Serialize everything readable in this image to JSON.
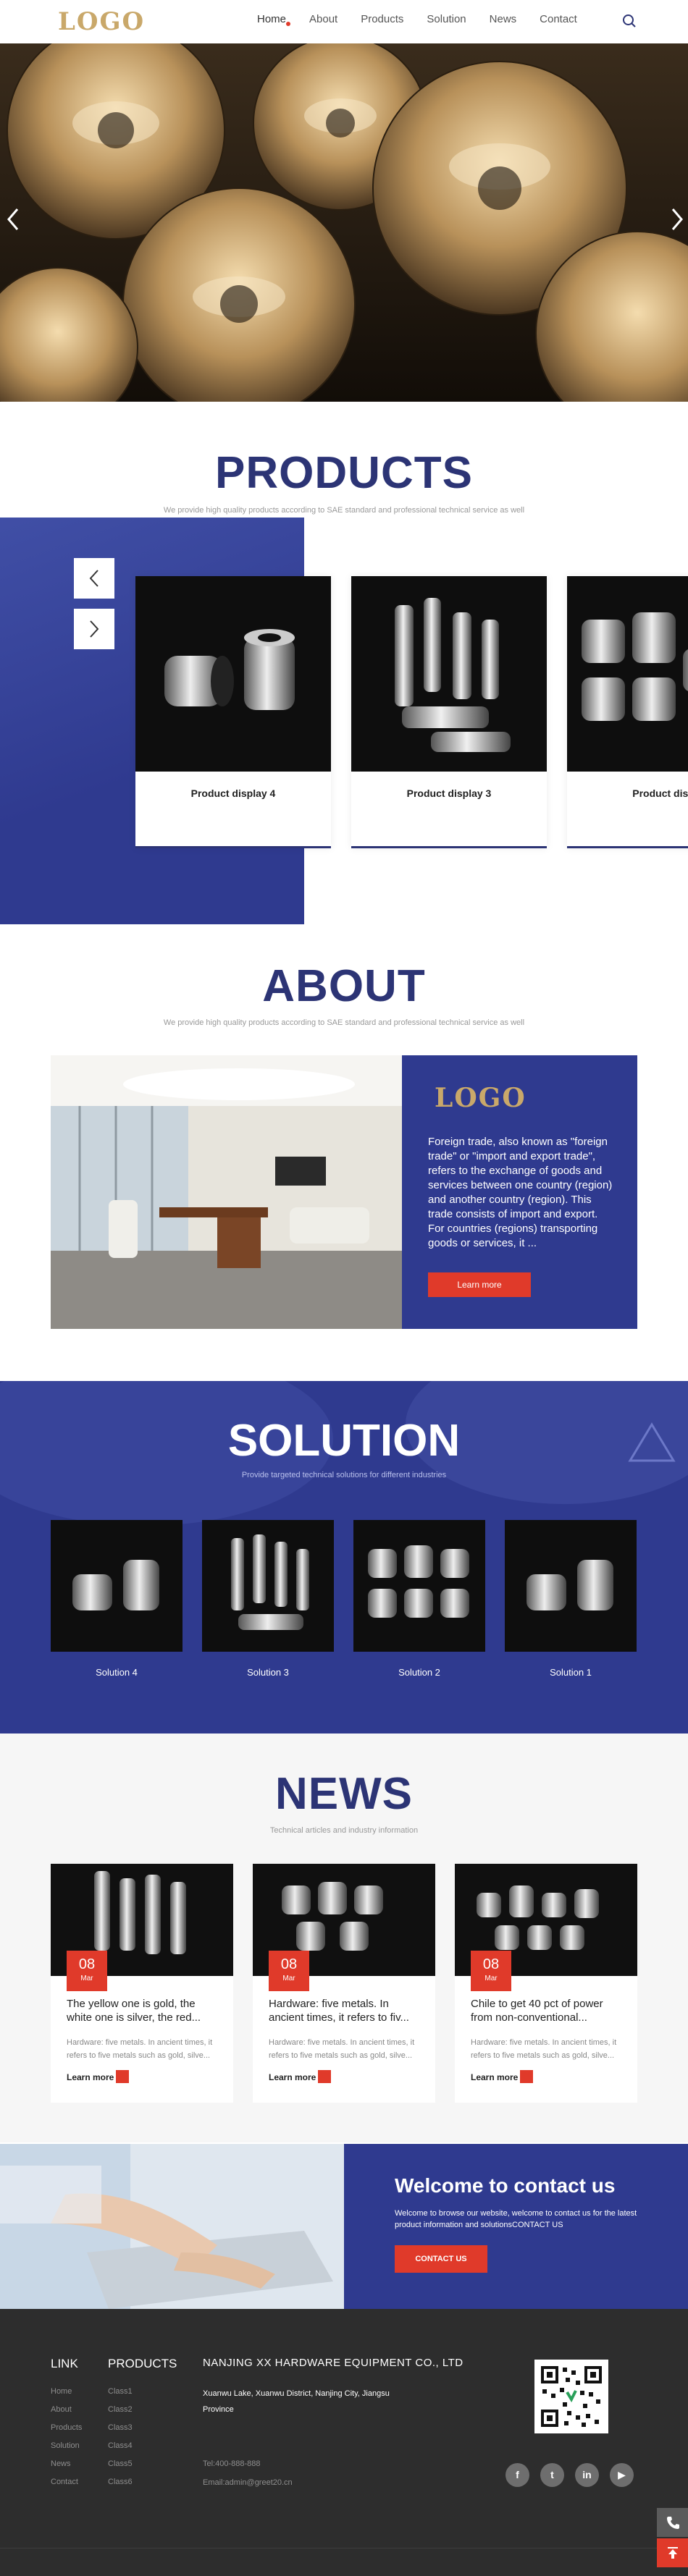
{
  "header": {
    "logo": "LOGO",
    "nav": [
      {
        "label": "Home"
      },
      {
        "label": "About"
      },
      {
        "label": "Products"
      },
      {
        "label": "Solution"
      },
      {
        "label": "News"
      },
      {
        "label": "Contact"
      }
    ],
    "search_icon": "search-icon"
  },
  "hero": {
    "prev_icon": "chevron-left-icon",
    "next_icon": "chevron-right-icon"
  },
  "products": {
    "title": "PRODUCTS",
    "subtitle": "We provide high quality products according to SAE standard and professional technical service as well",
    "prev_icon": "chevron-left-icon",
    "next_icon": "chevron-right-icon",
    "items": [
      {
        "name": "Product display 4"
      },
      {
        "name": "Product display 3"
      },
      {
        "name": "Product displ"
      }
    ]
  },
  "about": {
    "title": "ABOUT",
    "subtitle": "We provide high quality products according to SAE standard and professional technical service as well",
    "logo": "LOGO",
    "text": "Foreign trade, also known as \"foreign trade\" or \"import and export trade\", refers to the exchange of goods and services between one country (region) and another country (region). This trade consists of import and export. For countries (regions) transporting goods or services, it ...",
    "button": "Learn more"
  },
  "solution": {
    "title": "SOLUTION",
    "subtitle": "Provide targeted technical solutions for different industries",
    "items": [
      {
        "name": "Solution 4"
      },
      {
        "name": "Solution 3"
      },
      {
        "name": "Solution 2"
      },
      {
        "name": "Solution 1"
      }
    ]
  },
  "news": {
    "title": "NEWS",
    "subtitle": "Technical articles and industry information",
    "items": [
      {
        "day": "08",
        "month": "Mar",
        "title": "The yellow one is gold, the white one is silver, the red...",
        "desc": "Hardware: five metals. In ancient times, it refers to five metals such as gold, silve...",
        "more": "Learn more"
      },
      {
        "day": "08",
        "month": "Mar",
        "title": "Hardware: five metals. In ancient times, it refers to fiv...",
        "desc": "Hardware: five metals. In ancient times, it refers to five metals such as gold, silve...",
        "more": "Learn more"
      },
      {
        "day": "08",
        "month": "Mar",
        "title": "Chile to get 40 pct of power from non-conventional...",
        "desc": "Hardware: five metals. In ancient times, it refers to five metals such as gold, silve...",
        "more": "Learn more"
      }
    ]
  },
  "contact": {
    "title": "Welcome to contact us",
    "text": "Welcome to browse our website, welcome to contact us for the latest product information and solutionsCONTACT US",
    "button": "CONTACT US"
  },
  "footer": {
    "link_title": "LINK",
    "links": [
      "Home",
      "About",
      "Products",
      "Solution",
      "News",
      "Contact"
    ],
    "products_title": "PRODUCTS",
    "products": [
      "Class1",
      "Class2",
      "Class3",
      "Class4",
      "Class5",
      "Class6"
    ],
    "company": "NANJING XX HARDWARE EQUIPMENT CO., LTD",
    "address": "Xuanwu Lake, Xuanwu District, Nanjing City, Jiangsu Province",
    "tel": "Tel:400-888-888",
    "email": "Email:admin@greet20.cn",
    "social": [
      {
        "icon": "facebook-icon",
        "glyph": "f"
      },
      {
        "icon": "twitter-icon",
        "glyph": "t"
      },
      {
        "icon": "linkedin-icon",
        "glyph": "in"
      },
      {
        "icon": "youtube-icon",
        "glyph": "▶"
      }
    ]
  },
  "colors": {
    "brand_blue": "#2f3a8f",
    "title_blue": "#2c3475",
    "accent_red": "#e03a2a",
    "logo_gold": "#c9a86a",
    "footer_bg": "#2d2d2d"
  }
}
